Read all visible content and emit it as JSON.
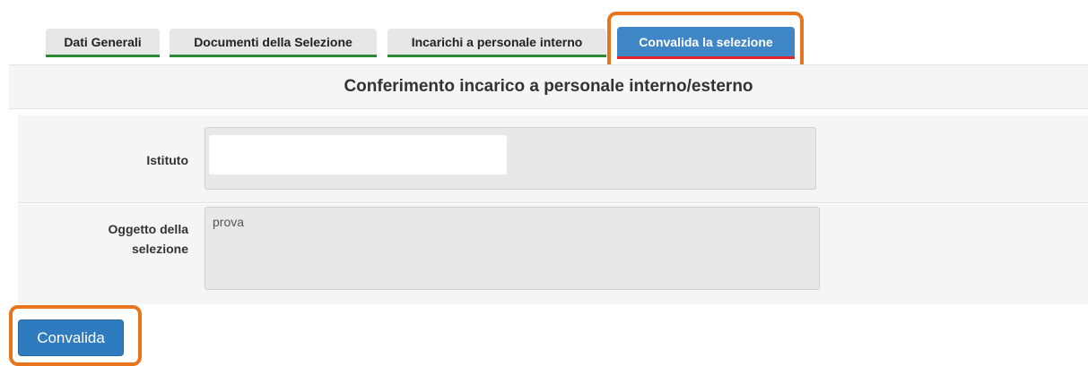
{
  "tabs": [
    {
      "label": "Dati Generali",
      "active": false
    },
    {
      "label": "Documenti della Selezione",
      "active": false
    },
    {
      "label": "Incarichi a personale interno",
      "active": false
    },
    {
      "label": "Convalida la selezione",
      "active": true
    }
  ],
  "panel": {
    "title": "Conferimento incarico a personale interno/esterno"
  },
  "form": {
    "istituto_label": "Istituto",
    "istituto_value": "",
    "oggetto_label_line1": "Oggetto della",
    "oggetto_label_line2": "selezione",
    "oggetto_value": "prova"
  },
  "actions": {
    "convalida_label": "Convalida"
  },
  "colors": {
    "active_tab": "#3f86c7",
    "highlight": "#e8741e",
    "button": "#2f7bbf"
  }
}
